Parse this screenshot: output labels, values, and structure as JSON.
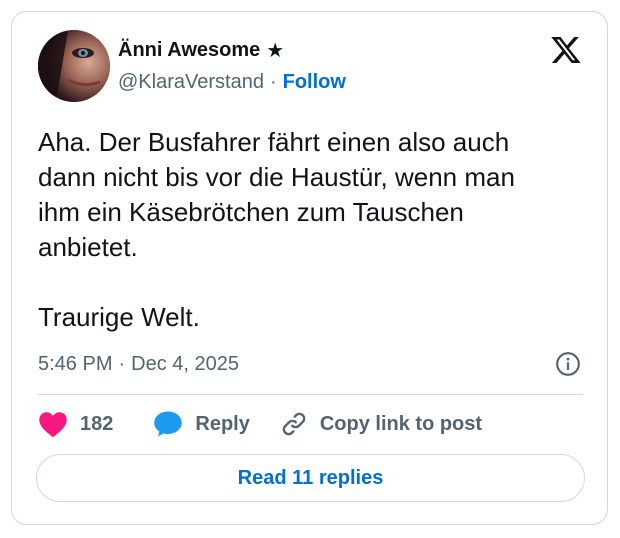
{
  "author": {
    "display_name": "Änni Awesome",
    "badge": "★",
    "handle": "@KlaraVerstand",
    "separator": "·",
    "follow_label": "Follow"
  },
  "tweet": {
    "text": "Aha. Der Busfahrer fährt einen also auch\ndann nicht bis vor die Haustür, wenn man\nihm ein Käsebrötchen zum Tauschen\nanbietet.\n\nTraurige Welt.",
    "time": "5:46 PM",
    "separator": "·",
    "date": "Dec 4, 2025"
  },
  "actions": {
    "like_count": "182",
    "reply_label": "Reply",
    "copy_link_label": "Copy link to post"
  },
  "footer": {
    "read_replies_label": "Read 11 replies"
  },
  "colors": {
    "accent": "#006fd6",
    "like": "#f91880",
    "reply": "#1d9bf0",
    "muted": "#536471",
    "border": "#cfd9de"
  },
  "icons": {
    "platform": "x-logo-icon",
    "info": "info-icon",
    "like": "heart-icon",
    "reply": "speech-bubble-icon",
    "copy": "link-icon"
  }
}
